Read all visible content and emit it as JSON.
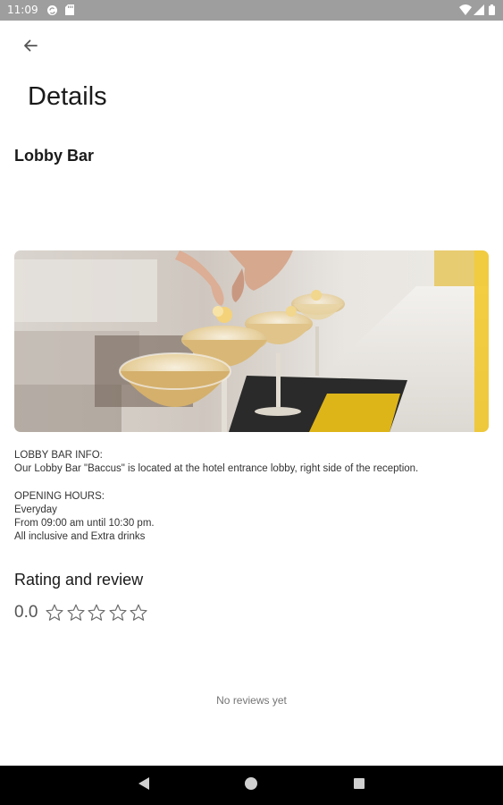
{
  "status_bar": {
    "time": "11:09",
    "icons": [
      "sync-icon",
      "sd-card-icon",
      "wifi-icon",
      "signal-icon",
      "battery-icon"
    ]
  },
  "app_bar": {
    "back_icon": "arrow-back-icon"
  },
  "page": {
    "title": "Details",
    "venue_name": "Lobby Bar"
  },
  "image": {
    "subject": "cocktail glasses on bar counter"
  },
  "description": {
    "lines_1": [
      "LOBBY BAR INFO:",
      "Our Lobby Bar \"Baccus\" is located at the hotel entrance lobby, right side of the reception."
    ],
    "lines_2": [
      "OPENING HOURS:",
      "Everyday",
      "From 09:00 am until 10:30 pm.",
      "All inclusive and Extra drinks"
    ]
  },
  "rating": {
    "heading": "Rating and review",
    "value": "0.0",
    "stars_filled": 0,
    "stars_total": 5
  },
  "reviews": {
    "empty_text": "No reviews yet"
  },
  "nav_bar": {
    "icons": [
      "back-triangle-icon",
      "home-circle-icon",
      "recents-square-icon"
    ]
  },
  "colors": {
    "status_bar": "#9e9e9e",
    "nav_bar": "#000000",
    "accent_yellow": "#f2c417"
  }
}
